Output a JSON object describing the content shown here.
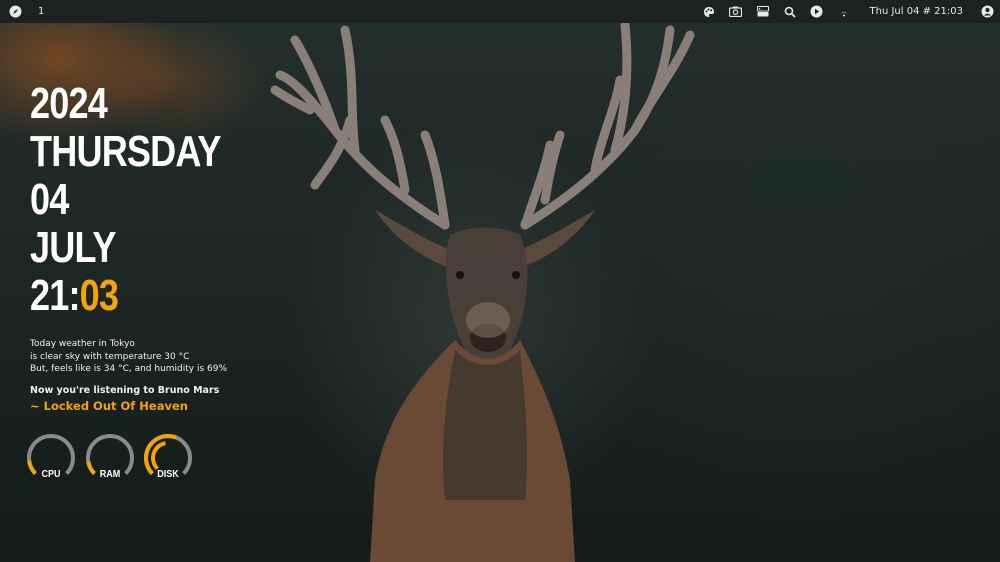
{
  "topbar": {
    "workspace": "1",
    "datetime": "Thu Jul 04 # 21:03",
    "icons": [
      "compass-icon",
      "palette-icon",
      "camera-icon",
      "server-icon",
      "search-icon",
      "play-icon",
      "wifi-icon",
      "user-icon"
    ]
  },
  "clock": {
    "year": "2024",
    "weekday": "THURSDAY",
    "day": "04",
    "month": "JULY",
    "hour": "21:",
    "minute": "03"
  },
  "weather": {
    "line1": "Today weather in Tokyo",
    "line2": "is clear sky with temperature 30 °C",
    "line3": "But, feels like is 34 °C, and humidity is 69%"
  },
  "music": {
    "title": "Now you're listening to Bruno Mars",
    "song": "~ Locked Out Of Heaven"
  },
  "gauges": [
    {
      "label": "CPU",
      "value": 0.14
    },
    {
      "label": "RAM",
      "value": 0.13
    },
    {
      "label": "DISK",
      "value": 0.58
    }
  ],
  "colors": {
    "accent": "#f5a20b",
    "bar": "#1d2121",
    "gauge_track": "#8a8a8a"
  }
}
